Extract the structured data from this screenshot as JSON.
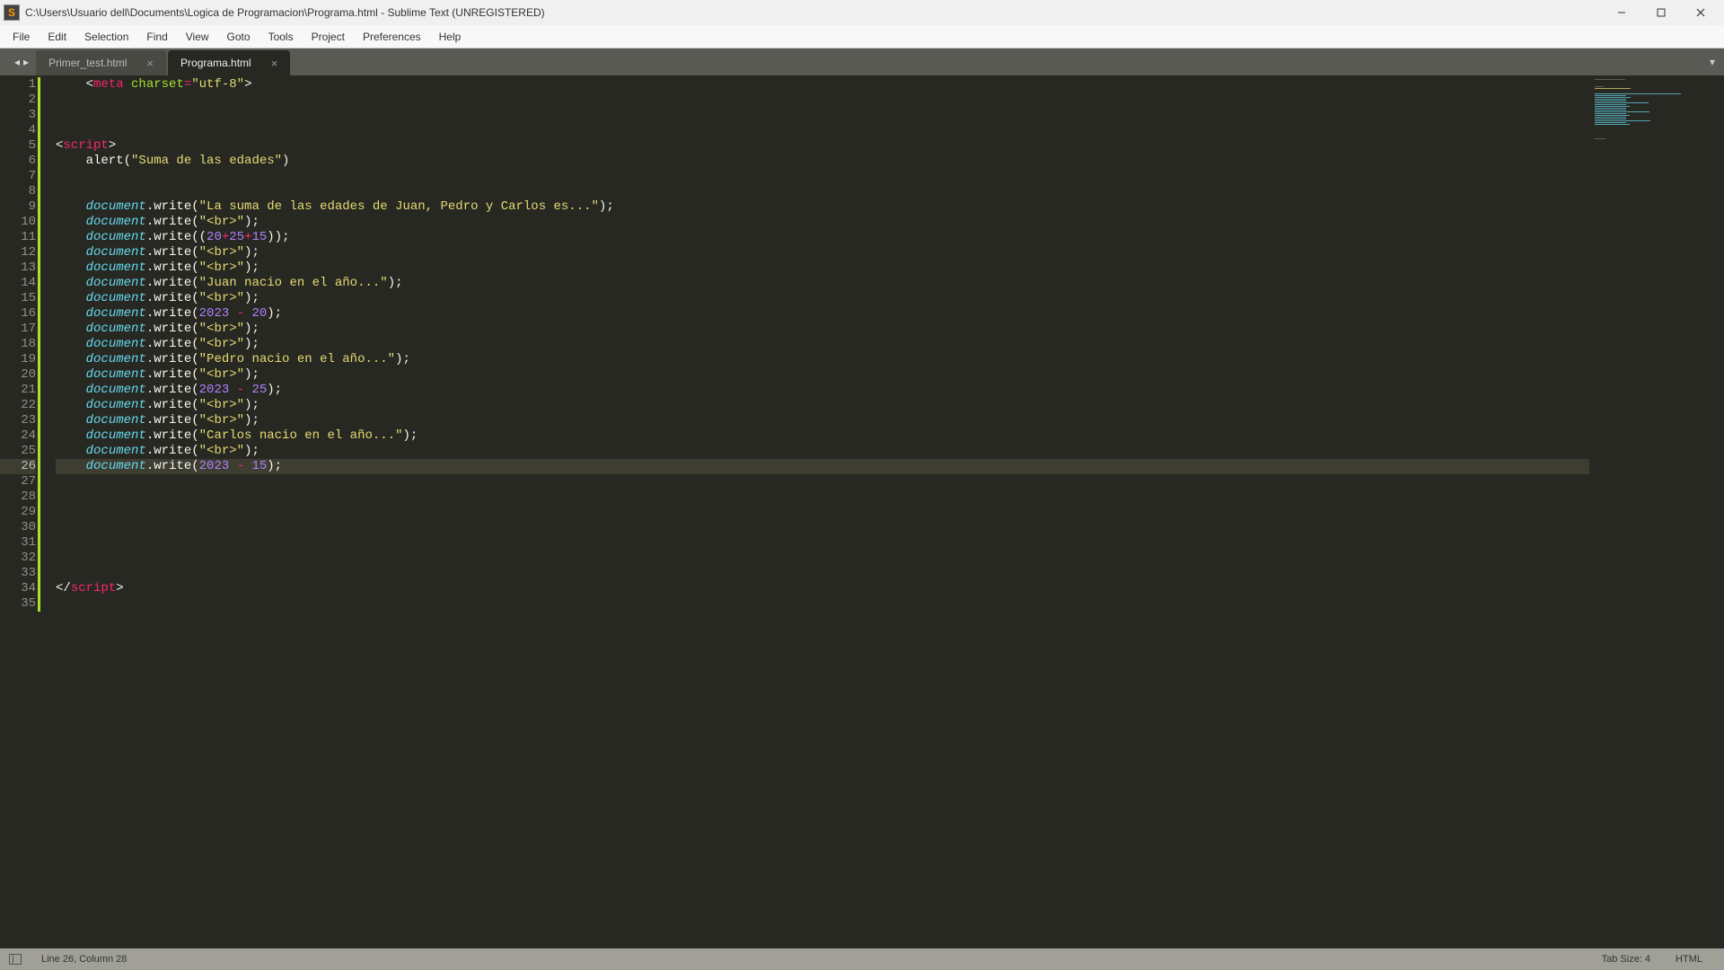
{
  "window": {
    "title": "C:\\Users\\Usuario dell\\Documents\\Logica de Programacion\\Programa.html - Sublime Text (UNREGISTERED)",
    "app_icon_text": "S"
  },
  "menu": {
    "items": [
      "File",
      "Edit",
      "Selection",
      "Find",
      "View",
      "Goto",
      "Tools",
      "Project",
      "Preferences",
      "Help"
    ]
  },
  "tabs": {
    "items": [
      {
        "label": "Primer_test.html",
        "active": false
      },
      {
        "label": "Programa.html",
        "active": true
      }
    ]
  },
  "editor": {
    "line_count": 35,
    "current_line": 26,
    "code_lines": [
      {
        "n": 1,
        "segs": [
          {
            "t": "    <",
            "c": "c-punc"
          },
          {
            "t": "meta",
            "c": "c-tag"
          },
          {
            "t": " ",
            "c": "c-plain"
          },
          {
            "t": "charset",
            "c": "c-attr"
          },
          {
            "t": "=",
            "c": "c-op"
          },
          {
            "t": "\"utf-8\"",
            "c": "c-str"
          },
          {
            "t": ">",
            "c": "c-punc"
          }
        ]
      },
      {
        "n": 2,
        "segs": []
      },
      {
        "n": 3,
        "segs": []
      },
      {
        "n": 4,
        "segs": []
      },
      {
        "n": 5,
        "segs": [
          {
            "t": "<",
            "c": "c-punc"
          },
          {
            "t": "script",
            "c": "c-tag"
          },
          {
            "t": ">",
            "c": "c-punc"
          }
        ]
      },
      {
        "n": 6,
        "segs": [
          {
            "t": "    alert(",
            "c": "c-plain"
          },
          {
            "t": "\"Suma de las edades\"",
            "c": "c-str"
          },
          {
            "t": ")",
            "c": "c-plain"
          }
        ]
      },
      {
        "n": 7,
        "segs": []
      },
      {
        "n": 8,
        "segs": []
      },
      {
        "n": 9,
        "segs": [
          {
            "t": "    ",
            "c": "c-plain"
          },
          {
            "t": "document",
            "c": "c-fn"
          },
          {
            "t": ".write(",
            "c": "c-plain"
          },
          {
            "t": "\"La suma de las edades de Juan, Pedro y Carlos es...\"",
            "c": "c-str"
          },
          {
            "t": ");",
            "c": "c-plain"
          }
        ]
      },
      {
        "n": 10,
        "segs": [
          {
            "t": "    ",
            "c": "c-plain"
          },
          {
            "t": "document",
            "c": "c-fn"
          },
          {
            "t": ".write(",
            "c": "c-plain"
          },
          {
            "t": "\"<br>\"",
            "c": "c-str"
          },
          {
            "t": ");",
            "c": "c-plain"
          }
        ]
      },
      {
        "n": 11,
        "segs": [
          {
            "t": "    ",
            "c": "c-plain"
          },
          {
            "t": "document",
            "c": "c-fn"
          },
          {
            "t": ".write((",
            "c": "c-plain"
          },
          {
            "t": "20",
            "c": "c-num"
          },
          {
            "t": "+",
            "c": "c-op"
          },
          {
            "t": "25",
            "c": "c-num"
          },
          {
            "t": "+",
            "c": "c-op"
          },
          {
            "t": "15",
            "c": "c-num"
          },
          {
            "t": "));",
            "c": "c-plain"
          }
        ]
      },
      {
        "n": 12,
        "segs": [
          {
            "t": "    ",
            "c": "c-plain"
          },
          {
            "t": "document",
            "c": "c-fn"
          },
          {
            "t": ".write(",
            "c": "c-plain"
          },
          {
            "t": "\"<br>\"",
            "c": "c-str"
          },
          {
            "t": ");",
            "c": "c-plain"
          }
        ]
      },
      {
        "n": 13,
        "segs": [
          {
            "t": "    ",
            "c": "c-plain"
          },
          {
            "t": "document",
            "c": "c-fn"
          },
          {
            "t": ".write(",
            "c": "c-plain"
          },
          {
            "t": "\"<br>\"",
            "c": "c-str"
          },
          {
            "t": ");",
            "c": "c-plain"
          }
        ]
      },
      {
        "n": 14,
        "segs": [
          {
            "t": "    ",
            "c": "c-plain"
          },
          {
            "t": "document",
            "c": "c-fn"
          },
          {
            "t": ".write(",
            "c": "c-plain"
          },
          {
            "t": "\"Juan nacio en el año...\"",
            "c": "c-str"
          },
          {
            "t": ");",
            "c": "c-plain"
          }
        ]
      },
      {
        "n": 15,
        "segs": [
          {
            "t": "    ",
            "c": "c-plain"
          },
          {
            "t": "document",
            "c": "c-fn"
          },
          {
            "t": ".write(",
            "c": "c-plain"
          },
          {
            "t": "\"<br>\"",
            "c": "c-str"
          },
          {
            "t": ");",
            "c": "c-plain"
          }
        ]
      },
      {
        "n": 16,
        "segs": [
          {
            "t": "    ",
            "c": "c-plain"
          },
          {
            "t": "document",
            "c": "c-fn"
          },
          {
            "t": ".write(",
            "c": "c-plain"
          },
          {
            "t": "2023",
            "c": "c-num"
          },
          {
            "t": " - ",
            "c": "c-op"
          },
          {
            "t": "20",
            "c": "c-num"
          },
          {
            "t": ");",
            "c": "c-plain"
          }
        ]
      },
      {
        "n": 17,
        "segs": [
          {
            "t": "    ",
            "c": "c-plain"
          },
          {
            "t": "document",
            "c": "c-fn"
          },
          {
            "t": ".write(",
            "c": "c-plain"
          },
          {
            "t": "\"<br>\"",
            "c": "c-str"
          },
          {
            "t": ");",
            "c": "c-plain"
          }
        ]
      },
      {
        "n": 18,
        "segs": [
          {
            "t": "    ",
            "c": "c-plain"
          },
          {
            "t": "document",
            "c": "c-fn"
          },
          {
            "t": ".write(",
            "c": "c-plain"
          },
          {
            "t": "\"<br>\"",
            "c": "c-str"
          },
          {
            "t": ");",
            "c": "c-plain"
          }
        ]
      },
      {
        "n": 19,
        "segs": [
          {
            "t": "    ",
            "c": "c-plain"
          },
          {
            "t": "document",
            "c": "c-fn"
          },
          {
            "t": ".write(",
            "c": "c-plain"
          },
          {
            "t": "\"Pedro nacio en el año...\"",
            "c": "c-str"
          },
          {
            "t": ");",
            "c": "c-plain"
          }
        ]
      },
      {
        "n": 20,
        "segs": [
          {
            "t": "    ",
            "c": "c-plain"
          },
          {
            "t": "document",
            "c": "c-fn"
          },
          {
            "t": ".write(",
            "c": "c-plain"
          },
          {
            "t": "\"<br>\"",
            "c": "c-str"
          },
          {
            "t": ");",
            "c": "c-plain"
          }
        ]
      },
      {
        "n": 21,
        "segs": [
          {
            "t": "    ",
            "c": "c-plain"
          },
          {
            "t": "document",
            "c": "c-fn"
          },
          {
            "t": ".write(",
            "c": "c-plain"
          },
          {
            "t": "2023",
            "c": "c-num"
          },
          {
            "t": " - ",
            "c": "c-op"
          },
          {
            "t": "25",
            "c": "c-num"
          },
          {
            "t": ");",
            "c": "c-plain"
          }
        ]
      },
      {
        "n": 22,
        "segs": [
          {
            "t": "    ",
            "c": "c-plain"
          },
          {
            "t": "document",
            "c": "c-fn"
          },
          {
            "t": ".write(",
            "c": "c-plain"
          },
          {
            "t": "\"<br>\"",
            "c": "c-str"
          },
          {
            "t": ");",
            "c": "c-plain"
          }
        ]
      },
      {
        "n": 23,
        "segs": [
          {
            "t": "    ",
            "c": "c-plain"
          },
          {
            "t": "document",
            "c": "c-fn"
          },
          {
            "t": ".write(",
            "c": "c-plain"
          },
          {
            "t": "\"<br>\"",
            "c": "c-str"
          },
          {
            "t": ");",
            "c": "c-plain"
          }
        ]
      },
      {
        "n": 24,
        "segs": [
          {
            "t": "    ",
            "c": "c-plain"
          },
          {
            "t": "document",
            "c": "c-fn"
          },
          {
            "t": ".write(",
            "c": "c-plain"
          },
          {
            "t": "\"Carlos nacio en el año...\"",
            "c": "c-str"
          },
          {
            "t": ");",
            "c": "c-plain"
          }
        ]
      },
      {
        "n": 25,
        "segs": [
          {
            "t": "    ",
            "c": "c-plain"
          },
          {
            "t": "document",
            "c": "c-fn"
          },
          {
            "t": ".write(",
            "c": "c-plain"
          },
          {
            "t": "\"<br>\"",
            "c": "c-str"
          },
          {
            "t": ");",
            "c": "c-plain"
          }
        ]
      },
      {
        "n": 26,
        "segs": [
          {
            "t": "    ",
            "c": "c-plain"
          },
          {
            "t": "document",
            "c": "c-fn"
          },
          {
            "t": ".write(",
            "c": "c-plain"
          },
          {
            "t": "2023",
            "c": "c-num"
          },
          {
            "t": " - ",
            "c": "c-op"
          },
          {
            "t": "15",
            "c": "c-num"
          },
          {
            "t": ");",
            "c": "c-plain"
          }
        ]
      },
      {
        "n": 27,
        "segs": []
      },
      {
        "n": 28,
        "segs": []
      },
      {
        "n": 29,
        "segs": []
      },
      {
        "n": 30,
        "segs": []
      },
      {
        "n": 31,
        "segs": []
      },
      {
        "n": 32,
        "segs": []
      },
      {
        "n": 33,
        "segs": []
      },
      {
        "n": 34,
        "segs": [
          {
            "t": "</",
            "c": "c-punc"
          },
          {
            "t": "script",
            "c": "c-tag"
          },
          {
            "t": ">",
            "c": "c-punc"
          }
        ]
      },
      {
        "n": 35,
        "segs": []
      }
    ]
  },
  "statusbar": {
    "position": "Line 26, Column 28",
    "tab_size": "Tab Size: 4",
    "syntax": "HTML"
  }
}
